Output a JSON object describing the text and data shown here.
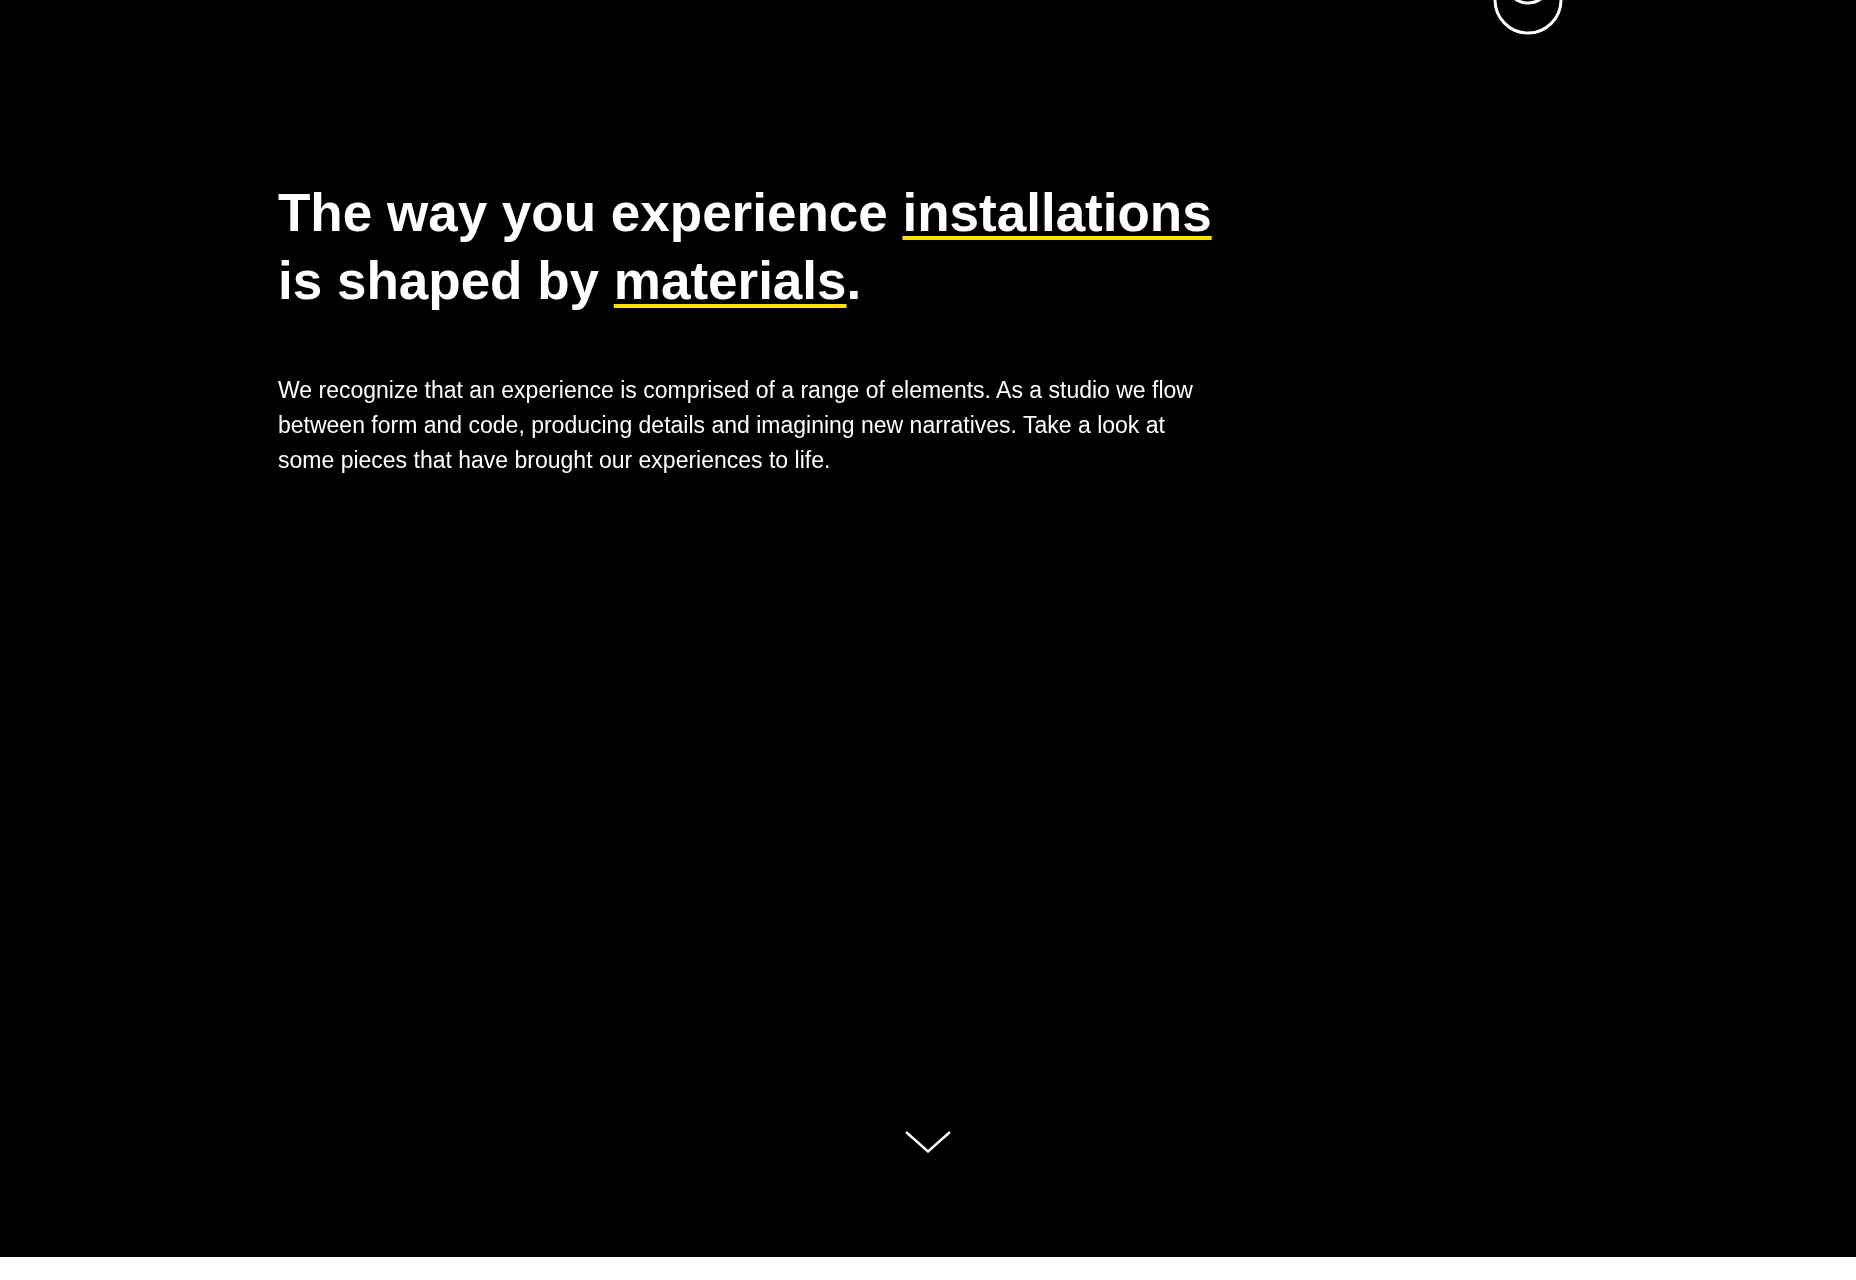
{
  "hero": {
    "headline": [
      {
        "kind": "text",
        "text": "The way you experience "
      },
      {
        "kind": "link",
        "text": "installations"
      },
      {
        "kind": "text",
        "text": " is shaped by "
      },
      {
        "kind": "link",
        "text": "materials"
      },
      {
        "kind": "text",
        "text": "."
      }
    ],
    "intro": "We recognize that an experience is comprised of a range of elements. As a studio we flow between form and code, producing details and imagining new narratives. Take a look at some pieces that have brought our experiences to life."
  }
}
